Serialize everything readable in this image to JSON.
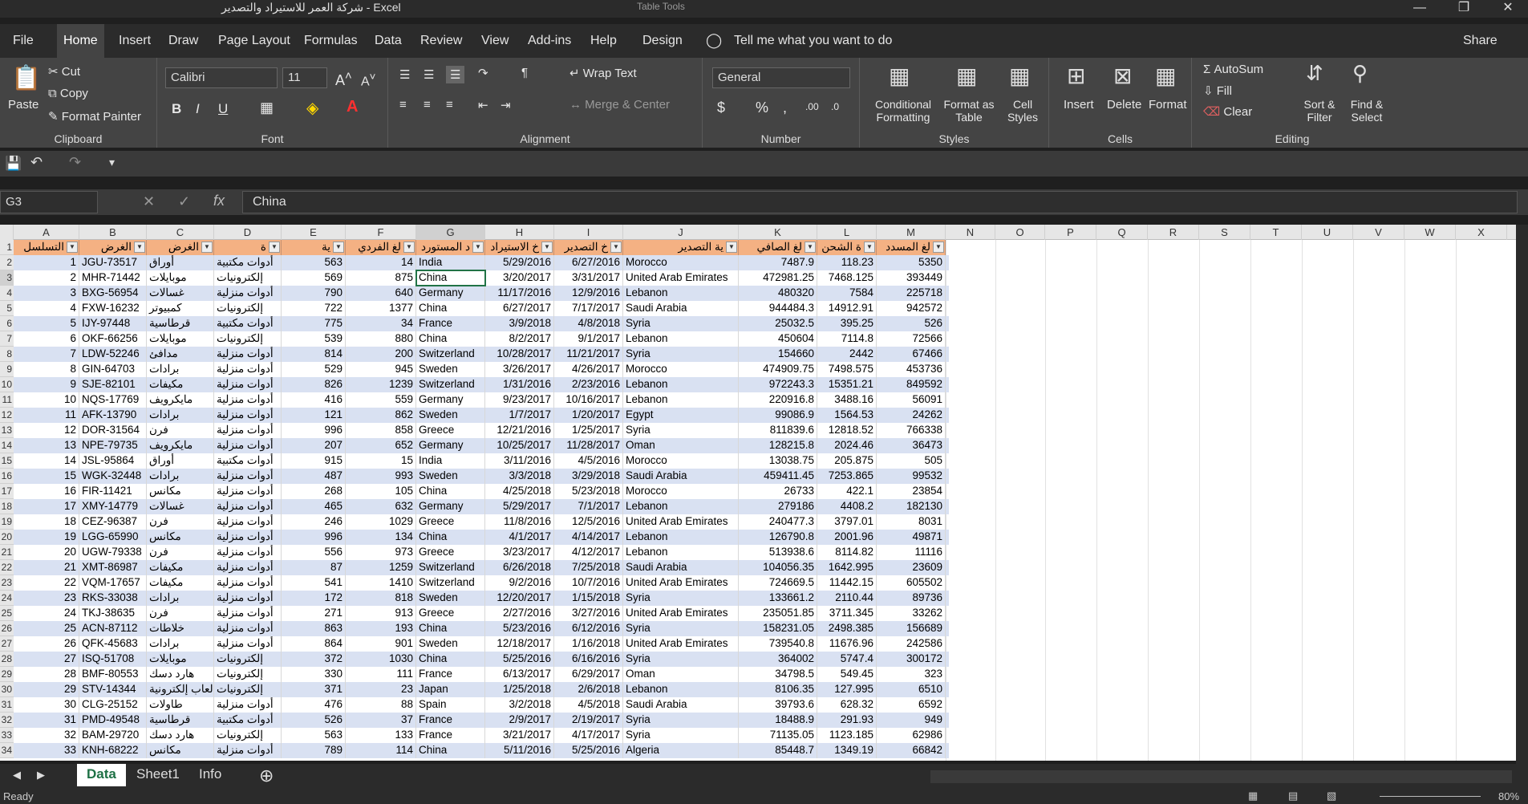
{
  "window": {
    "title": "شركة العمر للاستيراد والتصدير  -  Excel",
    "table_tools": "Table Tools"
  },
  "menu": {
    "items": [
      "File",
      "Home",
      "Insert",
      "Draw",
      "Page Layout",
      "Formulas",
      "Data",
      "Review",
      "View",
      "Add-ins",
      "Help",
      "Design"
    ],
    "tell": "Tell me what you want to do",
    "share": "Share"
  },
  "ribbon": {
    "clipboard": {
      "paste": "Paste",
      "cut": "Cut",
      "copy": "Copy",
      "format_painter": "Format Painter",
      "label": "Clipboard"
    },
    "font": {
      "name": "Calibri",
      "size": "11",
      "bold": "B",
      "italic": "I",
      "underline": "U",
      "label": "Font"
    },
    "alignment": {
      "wrap": "Wrap Text",
      "merge": "Merge & Center",
      "label": "Alignment"
    },
    "number": {
      "format": "General",
      "label": "Number"
    },
    "styles": {
      "cond": "Conditional Formatting",
      "fmt_table": "Format as Table",
      "cell_styles": "Cell Styles",
      "label": "Styles"
    },
    "cells": {
      "insert": "Insert",
      "delete": "Delete",
      "format": "Format",
      "label": "Cells"
    },
    "editing": {
      "autosum": "AutoSum",
      "fill": "Fill",
      "clear": "Clear",
      "sort": "Sort & Filter",
      "find": "Find & Select",
      "label": "Editing"
    }
  },
  "formula": {
    "namebox": "G3",
    "fx": "fx",
    "value": "China"
  },
  "columns": [
    "A",
    "B",
    "C",
    "D",
    "E",
    "F",
    "G",
    "H",
    "I",
    "J",
    "K",
    "L",
    "M",
    "N",
    "O",
    "P",
    "Q",
    "R",
    "S",
    "T",
    "U",
    "V",
    "W",
    "X"
  ],
  "headers": [
    "التسلسل",
    "الغرض",
    "الغرض",
    "ة",
    "ية",
    "لغ الفردي",
    "د المستورد",
    "خ الاستيراد",
    "خ التصدير",
    "ية التصدير",
    "لغ الصافي",
    "ة الشحن",
    "لغ المسدد"
  ],
  "rows": [
    [
      "1",
      "JGU-73517",
      "أوراق",
      "أدوات مكتبية",
      "563",
      "14",
      "India",
      "5/29/2016",
      "6/27/2016",
      "Morocco",
      "7487.9",
      "118.23",
      "5350"
    ],
    [
      "2",
      "MHR-71442",
      "موبايلات",
      "إلكترونيات",
      "569",
      "875",
      "China",
      "3/20/2017",
      "3/31/2017",
      "United Arab Emirates",
      "472981.25",
      "7468.125",
      "393449"
    ],
    [
      "3",
      "BXG-56954",
      "غسالات",
      "أدوات منزلية",
      "790",
      "640",
      "Germany",
      "11/17/2016",
      "12/9/2016",
      "Lebanon",
      "480320",
      "7584",
      "225718"
    ],
    [
      "4",
      "FXW-16232",
      "كمبيوتر",
      "إلكترونيات",
      "722",
      "1377",
      "China",
      "6/27/2017",
      "7/17/2017",
      "Saudi Arabia",
      "944484.3",
      "14912.91",
      "942572"
    ],
    [
      "5",
      "IJY-97448",
      "قرطاسية",
      "أدوات مكتبية",
      "775",
      "34",
      "France",
      "3/9/2018",
      "4/8/2018",
      "Syria",
      "25032.5",
      "395.25",
      "526"
    ],
    [
      "6",
      "OKF-66256",
      "موبايلات",
      "إلكترونيات",
      "539",
      "880",
      "China",
      "8/2/2017",
      "9/1/2017",
      "Lebanon",
      "450604",
      "7114.8",
      "72566"
    ],
    [
      "7",
      "LDW-52246",
      "مدافئ",
      "أدوات منزلية",
      "814",
      "200",
      "Switzerland",
      "10/28/2017",
      "11/21/2017",
      "Syria",
      "154660",
      "2442",
      "67466"
    ],
    [
      "8",
      "GIN-64703",
      "برادات",
      "أدوات منزلية",
      "529",
      "945",
      "Sweden",
      "3/26/2017",
      "4/26/2017",
      "Morocco",
      "474909.75",
      "7498.575",
      "453736"
    ],
    [
      "9",
      "SJE-82101",
      "مكيفات",
      "أدوات منزلية",
      "826",
      "1239",
      "Switzerland",
      "1/31/2016",
      "2/23/2016",
      "Lebanon",
      "972243.3",
      "15351.21",
      "849592"
    ],
    [
      "10",
      "NQS-17769",
      "مايكرويف",
      "أدوات منزلية",
      "416",
      "559",
      "Germany",
      "9/23/2017",
      "10/16/2017",
      "Lebanon",
      "220916.8",
      "3488.16",
      "56091"
    ],
    [
      "11",
      "AFK-13790",
      "برادات",
      "أدوات منزلية",
      "121",
      "862",
      "Sweden",
      "1/7/2017",
      "1/20/2017",
      "Egypt",
      "99086.9",
      "1564.53",
      "24262"
    ],
    [
      "12",
      "DOR-31564",
      "فرن",
      "أدوات منزلية",
      "996",
      "858",
      "Greece",
      "12/21/2016",
      "1/25/2017",
      "Syria",
      "811839.6",
      "12818.52",
      "766338"
    ],
    [
      "13",
      "NPE-79735",
      "مايكرويف",
      "أدوات منزلية",
      "207",
      "652",
      "Germany",
      "10/25/2017",
      "11/28/2017",
      "Oman",
      "128215.8",
      "2024.46",
      "36473"
    ],
    [
      "14",
      "JSL-95864",
      "أوراق",
      "أدوات مكتبية",
      "915",
      "15",
      "India",
      "3/11/2016",
      "4/5/2016",
      "Morocco",
      "13038.75",
      "205.875",
      "505"
    ],
    [
      "15",
      "WGK-32448",
      "برادات",
      "أدوات منزلية",
      "487",
      "993",
      "Sweden",
      "3/3/2018",
      "3/29/2018",
      "Saudi Arabia",
      "459411.45",
      "7253.865",
      "99532"
    ],
    [
      "16",
      "FIR-11421",
      "مكانس",
      "أدوات منزلية",
      "268",
      "105",
      "China",
      "4/25/2018",
      "5/23/2018",
      "Morocco",
      "26733",
      "422.1",
      "23854"
    ],
    [
      "17",
      "XMY-14779",
      "غسالات",
      "أدوات منزلية",
      "465",
      "632",
      "Germany",
      "5/29/2017",
      "7/1/2017",
      "Lebanon",
      "279186",
      "4408.2",
      "182130"
    ],
    [
      "18",
      "CEZ-96387",
      "فرن",
      "أدوات منزلية",
      "246",
      "1029",
      "Greece",
      "11/8/2016",
      "12/5/2016",
      "United Arab Emirates",
      "240477.3",
      "3797.01",
      "8031"
    ],
    [
      "19",
      "LGG-65990",
      "مكانس",
      "أدوات منزلية",
      "996",
      "134",
      "China",
      "4/1/2017",
      "4/14/2017",
      "Lebanon",
      "126790.8",
      "2001.96",
      "49871"
    ],
    [
      "20",
      "UGW-79338",
      "فرن",
      "أدوات منزلية",
      "556",
      "973",
      "Greece",
      "3/23/2017",
      "4/12/2017",
      "Lebanon",
      "513938.6",
      "8114.82",
      "11116"
    ],
    [
      "21",
      "XMT-86987",
      "مكيفات",
      "أدوات منزلية",
      "87",
      "1259",
      "Switzerland",
      "6/26/2018",
      "7/25/2018",
      "Saudi Arabia",
      "104056.35",
      "1642.995",
      "23609"
    ],
    [
      "22",
      "VQM-17657",
      "مكيفات",
      "أدوات منزلية",
      "541",
      "1410",
      "Switzerland",
      "9/2/2016",
      "10/7/2016",
      "United Arab Emirates",
      "724669.5",
      "11442.15",
      "605502"
    ],
    [
      "23",
      "RKS-33038",
      "برادات",
      "أدوات منزلية",
      "172",
      "818",
      "Sweden",
      "12/20/2017",
      "1/15/2018",
      "Syria",
      "133661.2",
      "2110.44",
      "89736"
    ],
    [
      "24",
      "TKJ-38635",
      "فرن",
      "أدوات منزلية",
      "271",
      "913",
      "Greece",
      "2/27/2016",
      "3/27/2016",
      "United Arab Emirates",
      "235051.85",
      "3711.345",
      "33262"
    ],
    [
      "25",
      "ACN-87112",
      "خلاطات",
      "أدوات منزلية",
      "863",
      "193",
      "China",
      "5/23/2016",
      "6/12/2016",
      "Syria",
      "158231.05",
      "2498.385",
      "156689"
    ],
    [
      "26",
      "QFK-45683",
      "برادات",
      "أدوات منزلية",
      "864",
      "901",
      "Sweden",
      "12/18/2017",
      "1/16/2018",
      "United Arab Emirates",
      "739540.8",
      "11676.96",
      "242586"
    ],
    [
      "27",
      "ISQ-51708",
      "موبايلات",
      "إلكترونيات",
      "372",
      "1030",
      "China",
      "5/25/2016",
      "6/16/2016",
      "Syria",
      "364002",
      "5747.4",
      "300172"
    ],
    [
      "28",
      "BMF-80553",
      "هارد دسك",
      "إلكترونيات",
      "330",
      "111",
      "France",
      "6/13/2017",
      "6/29/2017",
      "Oman",
      "34798.5",
      "549.45",
      "323"
    ],
    [
      "29",
      "STV-14344",
      "ألعاب إلكترونية",
      "إلكترونيات",
      "371",
      "23",
      "Japan",
      "1/25/2018",
      "2/6/2018",
      "Lebanon",
      "8106.35",
      "127.995",
      "6510"
    ],
    [
      "30",
      "CLG-25152",
      "طاولات",
      "أدوات منزلية",
      "476",
      "88",
      "Spain",
      "3/2/2018",
      "4/5/2018",
      "Saudi Arabia",
      "39793.6",
      "628.32",
      "6592"
    ],
    [
      "31",
      "PMD-49548",
      "قرطاسية",
      "أدوات مكتبية",
      "526",
      "37",
      "France",
      "2/9/2017",
      "2/19/2017",
      "Syria",
      "18488.9",
      "291.93",
      "949"
    ],
    [
      "32",
      "BAM-29720",
      "هارد دسك",
      "إلكترونيات",
      "563",
      "133",
      "France",
      "3/21/2017",
      "4/17/2017",
      "Syria",
      "71135.05",
      "1123.185",
      "62986"
    ],
    [
      "33",
      "KNH-68222",
      "مكانس",
      "أدوات منزلية",
      "789",
      "114",
      "China",
      "5/11/2016",
      "5/25/2016",
      "Algeria",
      "85448.7",
      "1349.19",
      "66842"
    ]
  ],
  "sheets": [
    "Data",
    "Sheet1",
    "Info"
  ],
  "status": {
    "ready": "Ready",
    "zoom": "80%"
  },
  "colors": {
    "header_fill": "#f4b183",
    "band": "#d9e1f2",
    "select": "#217346"
  }
}
